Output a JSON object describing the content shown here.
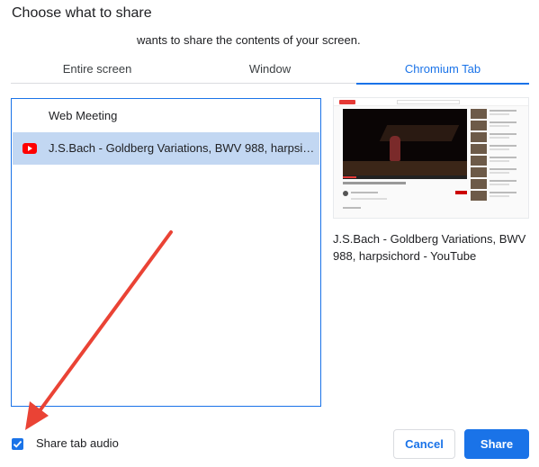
{
  "dialog": {
    "title": "Choose what to share",
    "subtitle": "wants to share the contents of your screen."
  },
  "tabs": [
    {
      "label": "Entire screen",
      "selected": false
    },
    {
      "label": "Window",
      "selected": false
    },
    {
      "label": "Chromium Tab",
      "selected": true
    }
  ],
  "list": {
    "items": [
      {
        "label": "Web Meeting",
        "icon": "none",
        "selected": false
      },
      {
        "label": "J.S.Bach - Goldberg Variations, BWV 988, harpsichord - YouTube",
        "icon": "youtube-icon",
        "selected": true
      }
    ]
  },
  "preview": {
    "caption": "J.S.Bach - Goldberg Variations, BWV 988, harpsichord - YouTube"
  },
  "audio": {
    "label": "Share tab audio",
    "checked": true
  },
  "buttons": {
    "cancel": "Cancel",
    "share": "Share"
  },
  "colors": {
    "accent": "#1a73e8",
    "selected_row": "#c2d7f2",
    "annotation_arrow": "#ea4335"
  }
}
